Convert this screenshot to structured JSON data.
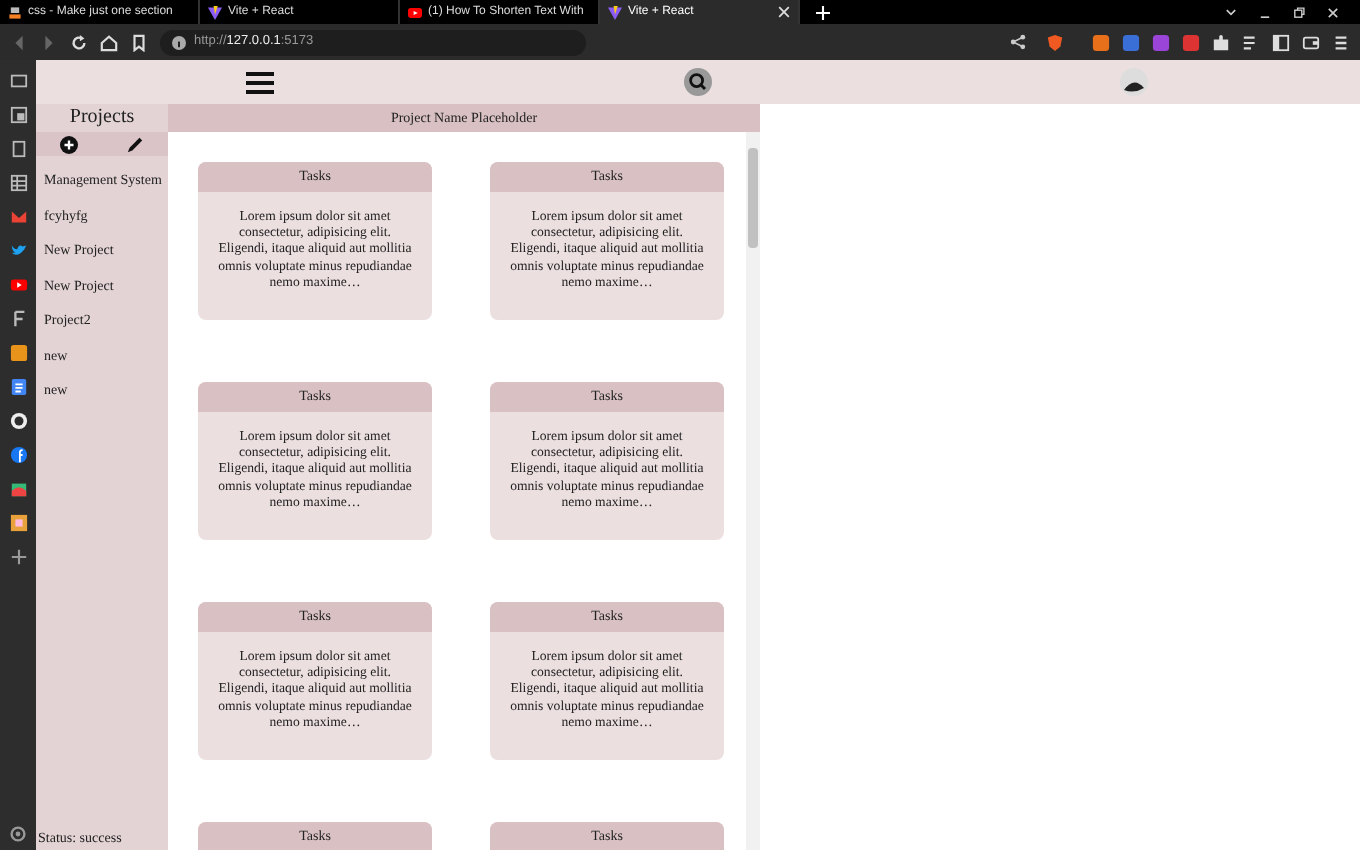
{
  "browser": {
    "tabs": [
      {
        "title": "css - Make just one section",
        "kind": "stack",
        "selected": false
      },
      {
        "title": "Vite + React",
        "kind": "vite",
        "selected": false
      },
      {
        "title": "(1) How To Shorten Text With",
        "kind": "video",
        "selected": false
      },
      {
        "title": "Vite + React",
        "kind": "vite",
        "selected": true
      }
    ],
    "url_scheme": "http://",
    "url_host": "127.0.0.1",
    "url_port": ":5173"
  },
  "app": {
    "sidebar": {
      "title": "Projects",
      "items": [
        "Management System",
        "fcyhyfg",
        "New Project",
        "New Project",
        "Project2",
        "new",
        "new"
      ],
      "status": "Status: success"
    },
    "project_title": "Project Name Placeholder",
    "cards": [
      {
        "title": "Tasks",
        "body": "Lorem ipsum dolor sit amet consectetur, adipisicing elit. Eligendi, itaque aliquid aut mollitia omnis voluptate minus repudiandae nemo maxime…"
      },
      {
        "title": "Tasks",
        "body": "Lorem ipsum dolor sit amet consectetur, adipisicing elit. Eligendi, itaque aliquid aut mollitia omnis voluptate minus repudiandae nemo maxime…"
      },
      {
        "title": "Tasks",
        "body": "Lorem ipsum dolor sit amet consectetur, adipisicing elit. Eligendi, itaque aliquid aut mollitia omnis voluptate minus repudiandae nemo maxime…"
      },
      {
        "title": "Tasks",
        "body": "Lorem ipsum dolor sit amet consectetur, adipisicing elit. Eligendi, itaque aliquid aut mollitia omnis voluptate minus repudiandae nemo maxime…"
      },
      {
        "title": "Tasks",
        "body": "Lorem ipsum dolor sit amet consectetur, adipisicing elit. Eligendi, itaque aliquid aut mollitia omnis voluptate minus repudiandae nemo maxime…"
      },
      {
        "title": "Tasks",
        "body": "Lorem ipsum dolor sit amet consectetur, adipisicing elit. Eligendi, itaque aliquid aut mollitia omnis voluptate minus repudiandae nemo maxime…"
      },
      {
        "title": "Tasks"
      },
      {
        "title": "Tasks"
      }
    ]
  }
}
